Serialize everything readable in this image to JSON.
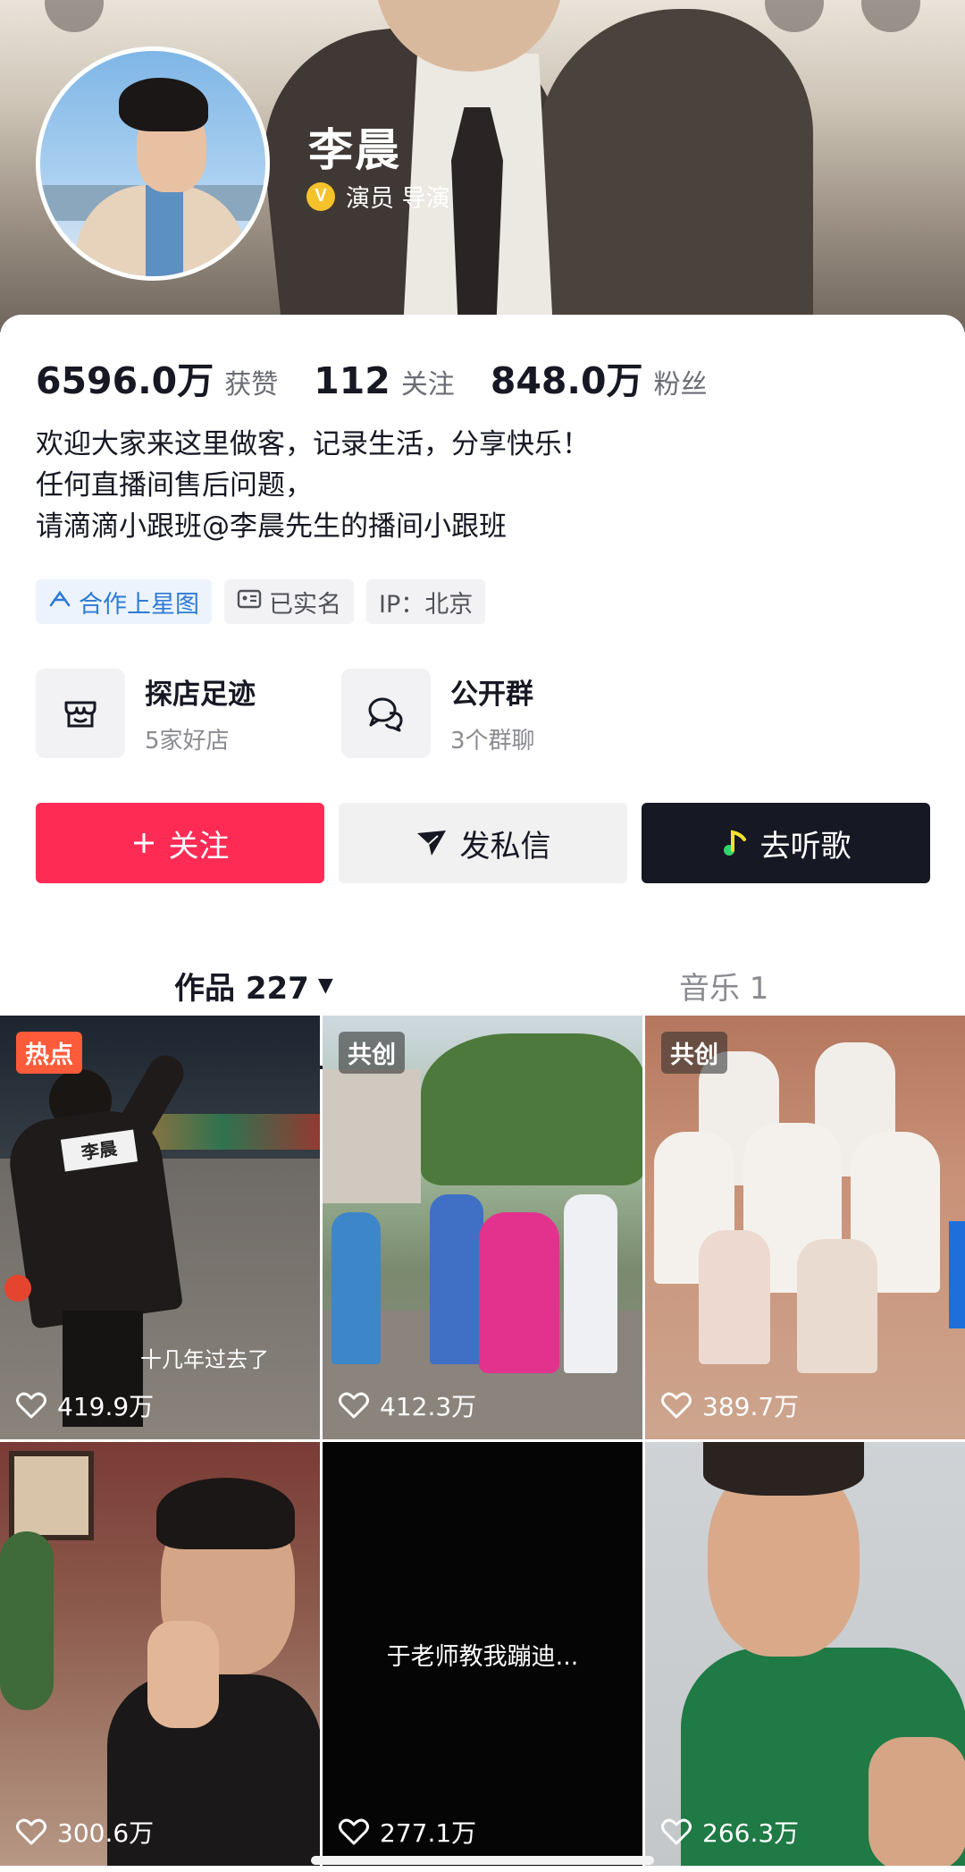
{
  "profile": {
    "name": "李晨",
    "verify_badge": "V",
    "verify_text": "演员 导演"
  },
  "stats": [
    {
      "value": "6596.0万",
      "label": "获赞"
    },
    {
      "value": "112",
      "label": "关注"
    },
    {
      "value": "848.0万",
      "label": "粉丝"
    }
  ],
  "bio": [
    "欢迎大家来这里做客，记录生活，分享快乐！",
    "任何直播间售后问题，",
    "请滴滴小跟班@李晨先生的播间小跟班"
  ],
  "tags": [
    {
      "label": "合作上星图",
      "icon": "star-map-icon"
    },
    {
      "label": "已实名",
      "icon": "id-card-icon"
    },
    {
      "label": "IP：北京",
      "icon": ""
    }
  ],
  "entries": [
    {
      "title": "探店足迹",
      "subtitle": "5家好店",
      "icon": "shop-icon"
    },
    {
      "title": "公开群",
      "subtitle": "3个群聊",
      "icon": "chat-bubbles-icon"
    }
  ],
  "buttons": {
    "follow": "关注",
    "message": "发私信",
    "music": "去听歌"
  },
  "tabs": {
    "works": "作品 227",
    "music": "音乐 1"
  },
  "videos": [
    {
      "likes": "419.9万",
      "badge": "热点",
      "caption": "十几年过去了"
    },
    {
      "likes": "412.3万",
      "badge": "共创",
      "caption": ""
    },
    {
      "likes": "389.7万",
      "badge": "共创",
      "caption": ""
    },
    {
      "likes": "300.6万",
      "badge": "",
      "caption": ""
    },
    {
      "likes": "277.1万",
      "badge": "",
      "caption": "于老师教我蹦迪..."
    },
    {
      "likes": "266.3万",
      "badge": "",
      "caption": ""
    }
  ],
  "colors": {
    "follow": "#fe2c55",
    "music_btn": "#161823",
    "tag_blue": "#2d7bd5",
    "badge_hot": "#fe5b3a"
  }
}
